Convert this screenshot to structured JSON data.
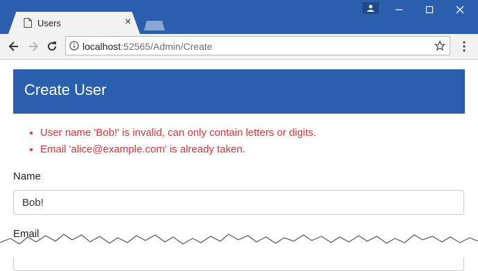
{
  "browser": {
    "tab": {
      "title": "Users",
      "close": "×"
    },
    "address_bar": {
      "host": "localhost",
      "rest": ":52565/Admin/Create"
    }
  },
  "page": {
    "heading": "Create User",
    "errors": [
      "User name 'Bob!' is invalid, can only contain letters or digits.",
      "Email 'alice@example.com' is already taken."
    ],
    "fields": {
      "name_label": "Name",
      "name_value": "Bob!",
      "email_label": "Email"
    }
  },
  "colors": {
    "titlebar": "#2b5fad",
    "panel_heading": "#2a5fad",
    "error_text": "#d0363b"
  },
  "icons": [
    "page-icon",
    "close-icon",
    "new-tab",
    "profile-icon",
    "minimize-icon",
    "maximize-icon",
    "close-window-icon",
    "back-arrow-icon",
    "forward-arrow-icon",
    "reload-icon",
    "info-icon",
    "star-icon",
    "menu-icon"
  ]
}
